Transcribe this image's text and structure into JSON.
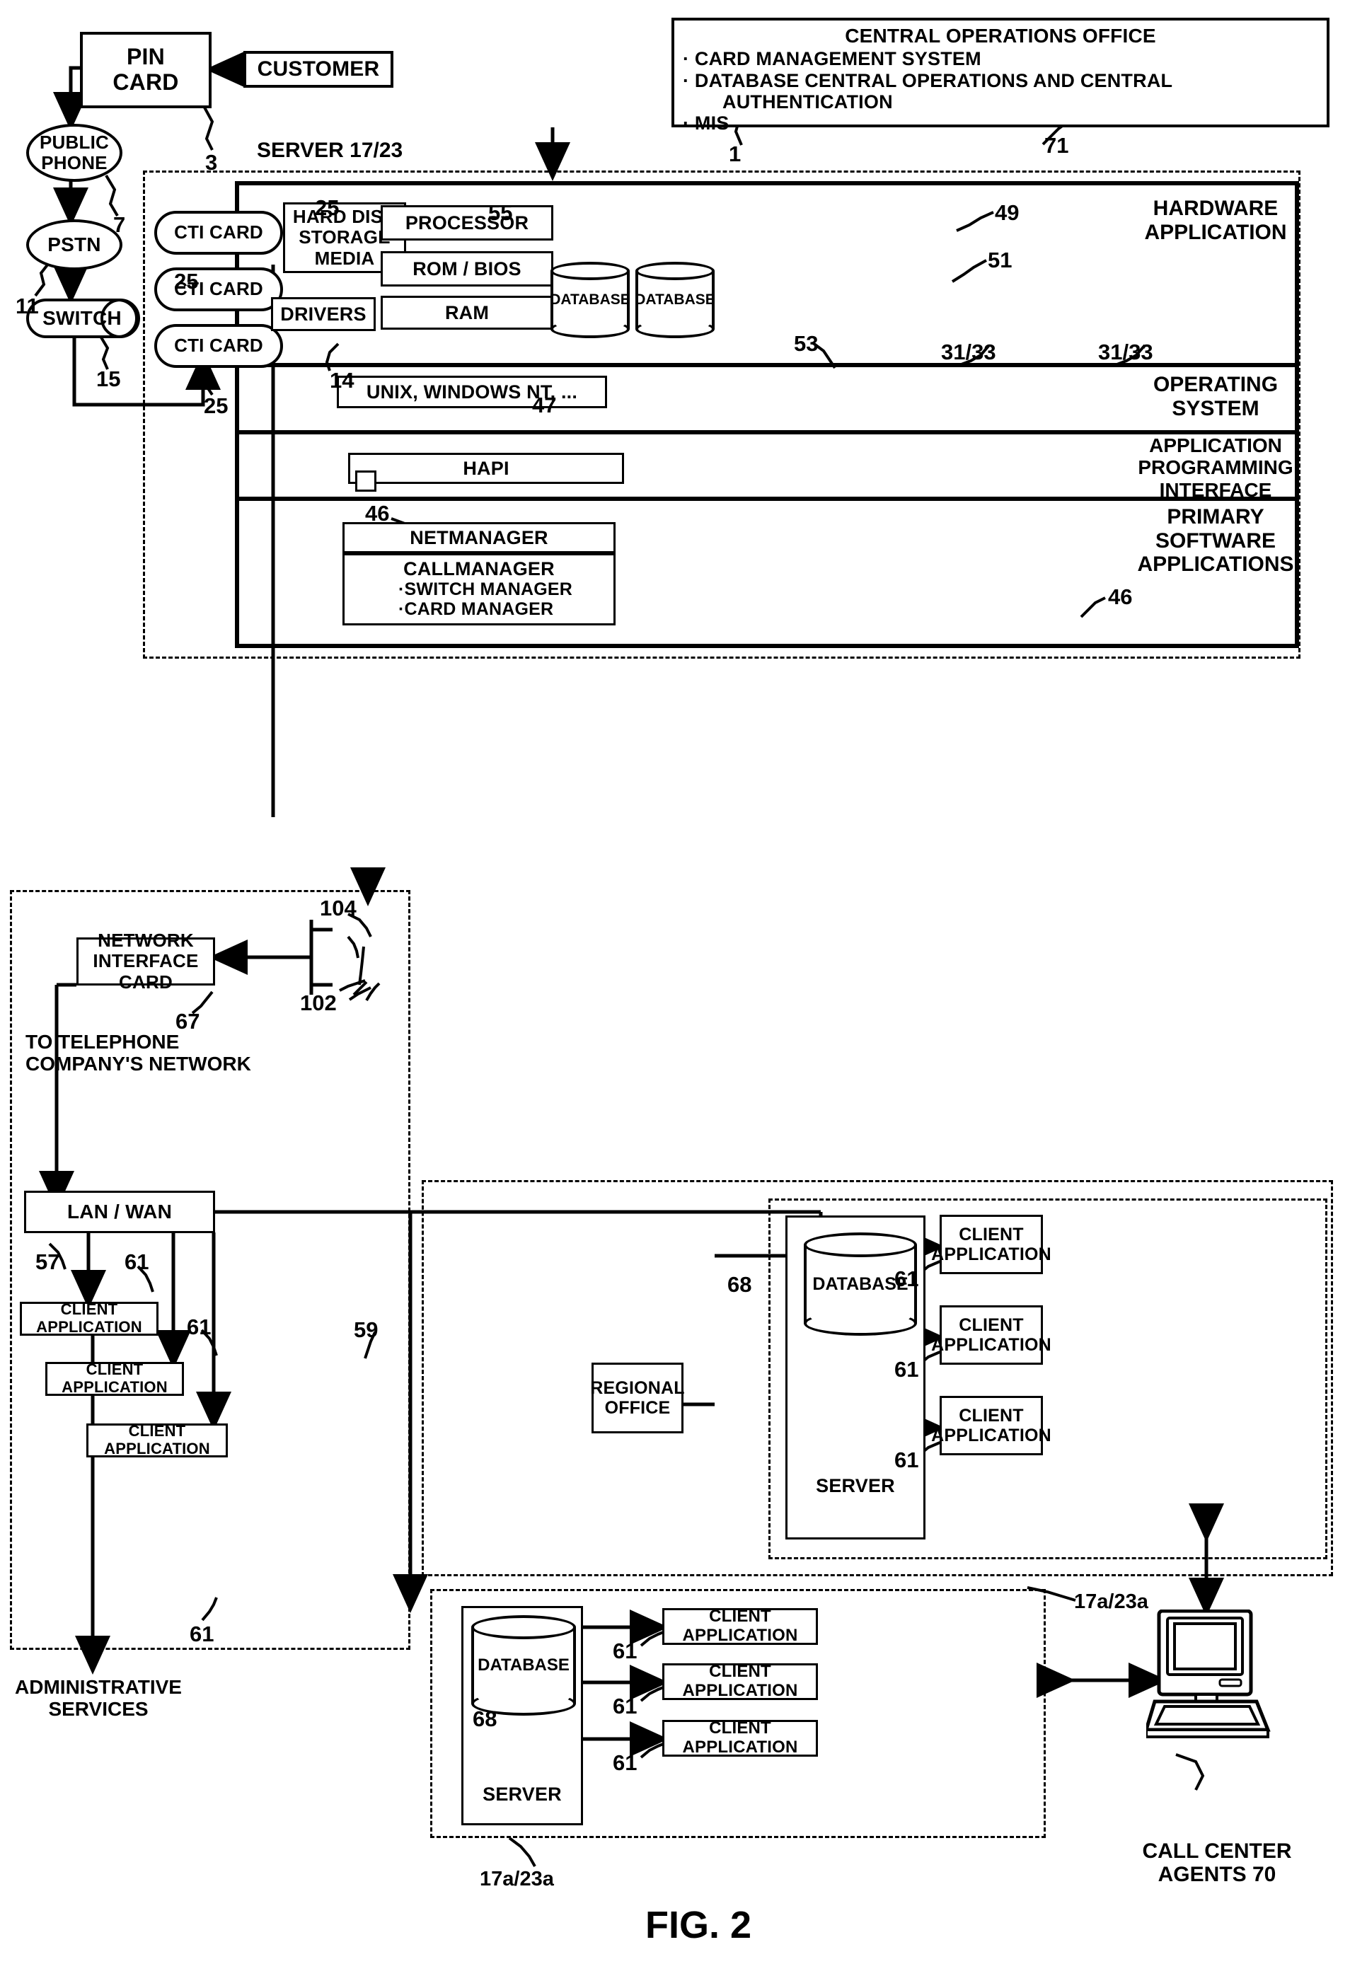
{
  "figure": {
    "label": "FIG. 2"
  },
  "top": {
    "pin_card": "PIN\nCARD",
    "customer": "CUSTOMER",
    "public_phone": "PUBLIC\nPHONE",
    "pstn": "PSTN",
    "switch": "SWITCH",
    "server_label": "SERVER 17/23",
    "central_office": {
      "title": "CENTRAL OPERATIONS OFFICE",
      "bullets": [
        "CARD MANAGEMENT SYSTEM",
        "DATABASE CENTRAL OPERATIONS AND CENTRAL",
        "AUTHENTICATION",
        "MIS"
      ]
    }
  },
  "cti_cards": [
    "CTI CARD",
    "CTI CARD",
    "CTI CARD"
  ],
  "hardware": {
    "section_title": "HARDWARE\nAPPLICATION",
    "hard_disk": "HARD DISK\nSTORAGE\nMEDIA",
    "processor": "PROCESSOR",
    "rom_bios": "ROM / BIOS",
    "drivers": "DRIVERS",
    "ram": "RAM",
    "database_a": "DATABASE",
    "database_b": "DATABASE"
  },
  "os": {
    "section_title": "OPERATING\nSYSTEM",
    "box": "UNIX, WINDOWS NT, ..."
  },
  "api": {
    "section_title": "APPLICATION\nPROGRAMMING\nINTERFACE",
    "box": "HAPI"
  },
  "primary_software": {
    "section_title": "PRIMARY\nSOFTWARE\nAPPLICATIONS",
    "netmanager": "NETMANAGER",
    "callmanager_title": "CALLMANAGER",
    "callmanager_bullets": [
      "SWITCH MANAGER",
      "CARD MANAGER"
    ]
  },
  "network": {
    "nic": "NETWORK\nINTERFACE CARD",
    "to_telco": "TO TELEPHONE\nCOMPANY'S NETWORK",
    "lan_wan": "LAN / WAN",
    "admin_services": "ADMINISTRATIVE\nSERVICES"
  },
  "admin_clients": [
    "CLIENT APPLICATION",
    "CLIENT APPLICATION",
    "CLIENT APPLICATION"
  ],
  "regional": {
    "office": "REGIONAL\nOFFICE"
  },
  "server_mid": {
    "database": "DATABASE",
    "server": "SERVER",
    "clients": [
      "CLIENT\nAPPLICATION",
      "CLIENT\nAPPLICATION",
      "CLIENT\nAPPLICATION"
    ]
  },
  "server_bottom": {
    "database": "DATABASE",
    "server": "SERVER",
    "clients": [
      "CLIENT APPLICATION",
      "CLIENT APPLICATION",
      "CLIENT APPLICATION"
    ]
  },
  "call_center": {
    "caption": "CALL CENTER\nAGENTS 70"
  },
  "reference_numerals": {
    "n1": "1",
    "n3": "3",
    "n7": "7",
    "n11": "11",
    "n14": "14",
    "n15": "15",
    "n25_a": "25",
    "n25_b": "25",
    "n25_c": "25",
    "n31_33_a": "31/33",
    "n31_33_b": "31/33",
    "n46_a": "46",
    "n46_b": "46",
    "n47": "47",
    "n49": "49",
    "n51": "51",
    "n53": "53",
    "n55": "55",
    "n57": "57",
    "n59": "59",
    "n61_a": "61",
    "n61_b": "61",
    "n61_c": "61",
    "n61_d": "61",
    "n61_e": "61",
    "n61_f": "61",
    "n61_g": "61",
    "n61_h": "61",
    "n61_i": "61",
    "n67": "67",
    "n68_a": "68",
    "n68_b": "68",
    "n71": "71",
    "n102": "102",
    "n104": "104",
    "n17a23a_a": "17a/23a",
    "n17a23a_b": "17a/23a"
  },
  "colors": {
    "ink": "#000000",
    "paper": "#ffffff"
  }
}
